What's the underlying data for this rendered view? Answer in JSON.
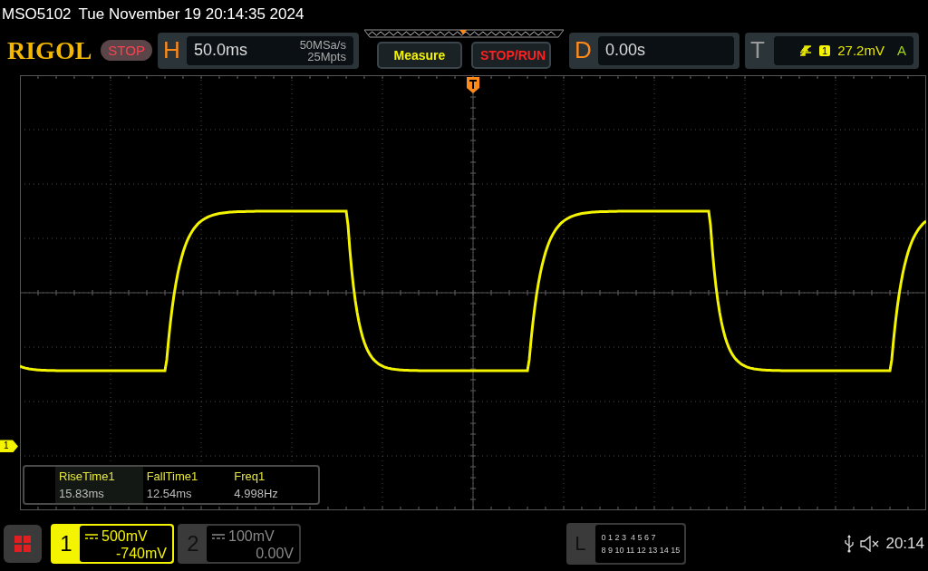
{
  "header": {
    "model": "MSO5102",
    "datetime": "Tue November 19 20:14:35 2024"
  },
  "toolbar": {
    "logo": "RIGOL",
    "run_state": "STOP",
    "horizontal": {
      "label": "H",
      "timebase": "50.0ms",
      "sample_rate": "50MSa/s",
      "memory_depth": "25Mpts"
    },
    "buttons": [
      {
        "label": "Measure",
        "kind": "measure"
      },
      {
        "label": "STOP/RUN",
        "kind": "run"
      }
    ],
    "delay": {
      "label": "D",
      "value": "0.00s"
    },
    "trigger": {
      "label": "T",
      "source": "1",
      "level": "27.2mV",
      "mode": "A"
    }
  },
  "display": {
    "channel_marker": "1",
    "measurements": [
      {
        "name": "RiseTime1",
        "value": "15.83ms"
      },
      {
        "name": "FallTime1",
        "value": "12.54ms"
      },
      {
        "name": "Freq1",
        "value": "4.998Hz"
      }
    ]
  },
  "bottom_bar": {
    "channels": [
      {
        "number": "1",
        "scale": "500mV",
        "offset": "-740mV",
        "on": true
      },
      {
        "number": "2",
        "scale": "100mV",
        "offset": "0.00V",
        "on": false
      }
    ],
    "logic": {
      "label": "L",
      "rows": [
        "0 1 2 3  4 5 6 7",
        "8 9 10 11 12 13 14 15"
      ]
    },
    "clock": "20:14"
  }
}
